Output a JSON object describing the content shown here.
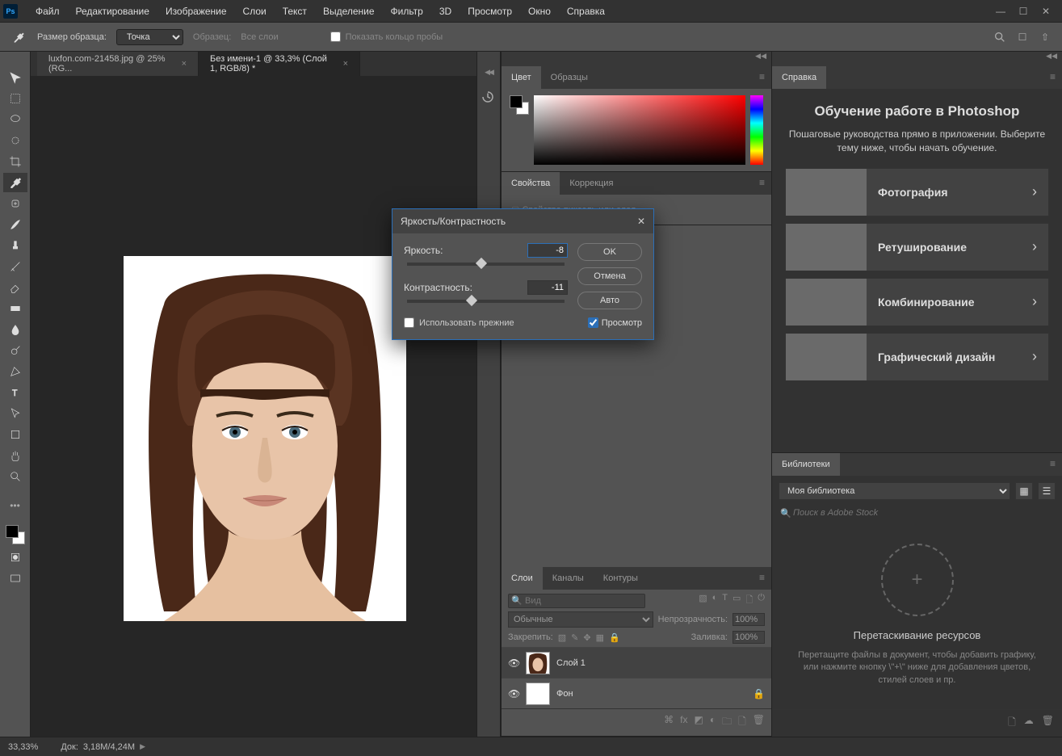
{
  "menubar": [
    "Файл",
    "Редактирование",
    "Изображение",
    "Слои",
    "Текст",
    "Выделение",
    "Фильтр",
    "3D",
    "Просмотр",
    "Окно",
    "Справка"
  ],
  "options": {
    "sample_size_label": "Размер образца:",
    "sample_size_value": "Точка",
    "sample_label": "Образец:",
    "sample_value": "Все слои",
    "show_ring": "Показать кольцо пробы"
  },
  "doc_tabs": [
    {
      "label": "luxfon.com-21458.jpg @ 25% (RG...",
      "active": false
    },
    {
      "label": "Без имени-1 @ 33,3% (Слой 1, RGB/8) *",
      "active": true
    }
  ],
  "panels": {
    "color": {
      "tabs": [
        "Цвет",
        "Образцы"
      ],
      "active": 0
    },
    "properties": {
      "tabs": [
        "Свойства",
        "Коррекция"
      ],
      "active": 0,
      "placeholder": "Свойства пиксель или слоя"
    },
    "layers": {
      "tabs": [
        "Слои",
        "Каналы",
        "Контуры"
      ],
      "active": 0,
      "search_placeholder": "Вид",
      "blend_mode": "Обычные",
      "opacity_label": "Непрозрачность:",
      "opacity_value": "100%",
      "lock_label": "Закрепить:",
      "fill_label": "Заливка:",
      "fill_value": "100%",
      "items": [
        {
          "name": "Слой 1",
          "locked": false,
          "active": true
        },
        {
          "name": "Фон",
          "locked": true,
          "active": false
        }
      ]
    },
    "learn": {
      "tab": "Справка",
      "title": "Обучение работе в Photoshop",
      "subtitle": "Пошаговые руководства прямо в приложении. Выберите тему ниже, чтобы начать обучение.",
      "items": [
        "Фотография",
        "Ретуширование",
        "Комбинирование",
        "Графический дизайн"
      ]
    },
    "libraries": {
      "tab": "Библиотеки",
      "library_select": "Моя библиотека",
      "search_placeholder": "Поиск в Adobe Stock",
      "drop_title": "Перетаскивание ресурсов",
      "drop_text": "Перетащите файлы в документ, чтобы добавить графику, или нажмите кнопку \\\"+\\\" ниже для добавления цветов, стилей слоев и пр."
    }
  },
  "dialog": {
    "title": "Яркость/Контрастность",
    "brightness_label": "Яркость:",
    "brightness_value": "-8",
    "contrast_label": "Контрастность:",
    "contrast_value": "-11",
    "legacy_label": "Использовать прежние",
    "ok": "OK",
    "cancel": "Отмена",
    "auto": "Авто",
    "preview": "Просмотр"
  },
  "status": {
    "zoom": "33,33%",
    "doc_label": "Док:",
    "doc_value": "3,18M/4,24M"
  }
}
